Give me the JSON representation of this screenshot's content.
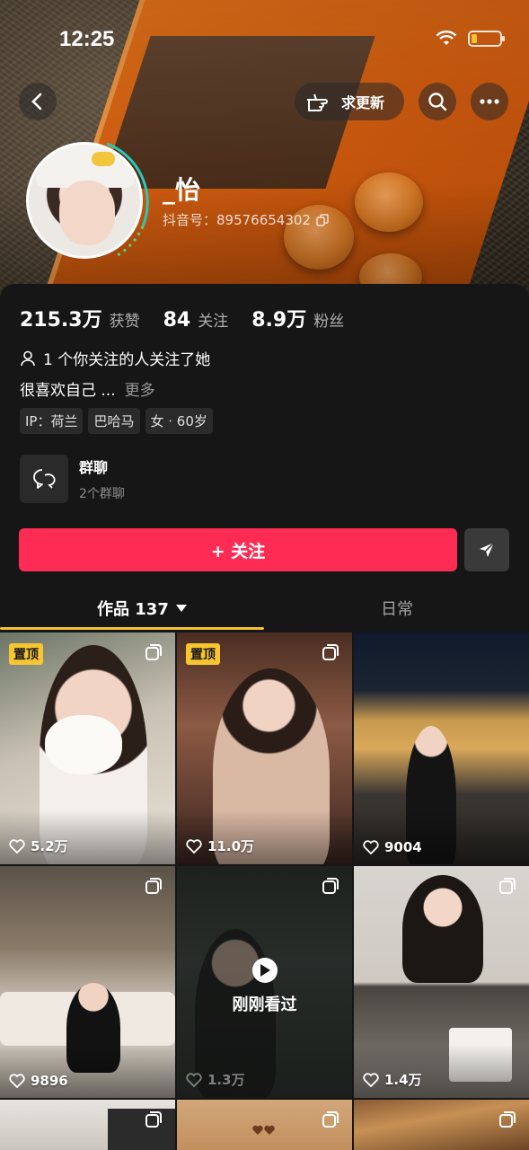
{
  "status_bar": {
    "time": "12:25"
  },
  "nav": {
    "update_label": "求更新"
  },
  "profile": {
    "name": "_怡",
    "id_label": "抖音号：89576654302"
  },
  "stats": [
    {
      "value": "215.3万",
      "label": "获赞"
    },
    {
      "value": "84",
      "label": "关注"
    },
    {
      "value": "8.9万",
      "label": "粉丝"
    }
  ],
  "mutual_text": "1 个你关注的人关注了她",
  "bio": {
    "text": "很喜欢自己 ...",
    "more": "更多"
  },
  "tags": [
    "IP：荷兰",
    "巴哈马",
    "女 · 60岁"
  ],
  "group": {
    "title": "群聊",
    "subtitle": "2个群聊"
  },
  "follow_label": "+ 关注",
  "tabs": {
    "works": "作品 137",
    "daily": "日常"
  },
  "pin_label": "置顶",
  "watched_label": "刚刚看过",
  "videos": [
    {
      "likes": "5.2万",
      "pinned": true
    },
    {
      "likes": "11.0万",
      "pinned": true
    },
    {
      "likes": "9004",
      "pinned": false
    },
    {
      "likes": "9896",
      "pinned": false
    },
    {
      "likes": "1.3万",
      "pinned": false,
      "watched": true
    },
    {
      "likes": "1.4万",
      "pinned": false
    }
  ],
  "colors": {
    "accent": "#fe2c55",
    "pin": "#f7c531",
    "tab_indicator": "#f2c230"
  }
}
